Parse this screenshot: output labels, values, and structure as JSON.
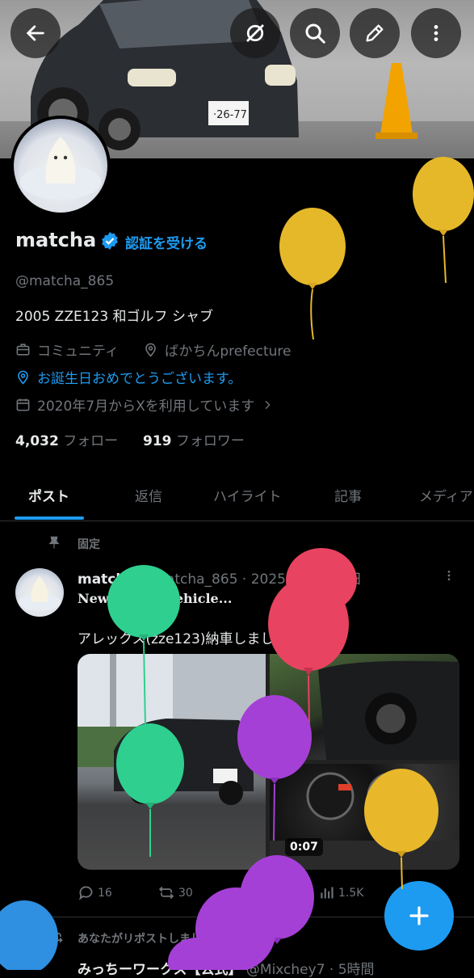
{
  "header": {
    "buttons": [
      "back-icon",
      "grok-icon",
      "search-icon",
      "edit-icon",
      "more-icon"
    ]
  },
  "profile": {
    "name": "matcha",
    "verify_label": "認証を受ける",
    "handle": "@matcha_865",
    "bio": "2005 ZZE123 和ゴルフ シャブ",
    "category": "コミュニティ",
    "location": "ばかちんprefecture",
    "birthday": "お誕生日おめでとうございます。",
    "joined": "2020年7月からXを利用しています",
    "following_count": "4,032",
    "following_label": "フォロー",
    "followers_count": "919",
    "followers_label": "フォロワー"
  },
  "tabs": [
    "ポスト",
    "返信",
    "ハイライト",
    "記事",
    "メディア"
  ],
  "pinned_label": "固定",
  "post": {
    "author": "matcha",
    "meta": "@matcha_865 · 2025年07月25日",
    "badge": "NewCenturyVehicle...",
    "text": "アレックス(zze123)納車しました！",
    "video_time": "0:07",
    "replies": "16",
    "reposts": "30",
    "likes": "251",
    "views": "1.5K"
  },
  "next_post": {
    "repost_label": "あなたがリポストしました",
    "author": "みっちーワークス【公式】",
    "meta": "@Mixchey7 · 5時間"
  },
  "colors": {
    "accent": "#1d9bf0",
    "muted": "#71767b",
    "text": "#e7e9ea"
  }
}
